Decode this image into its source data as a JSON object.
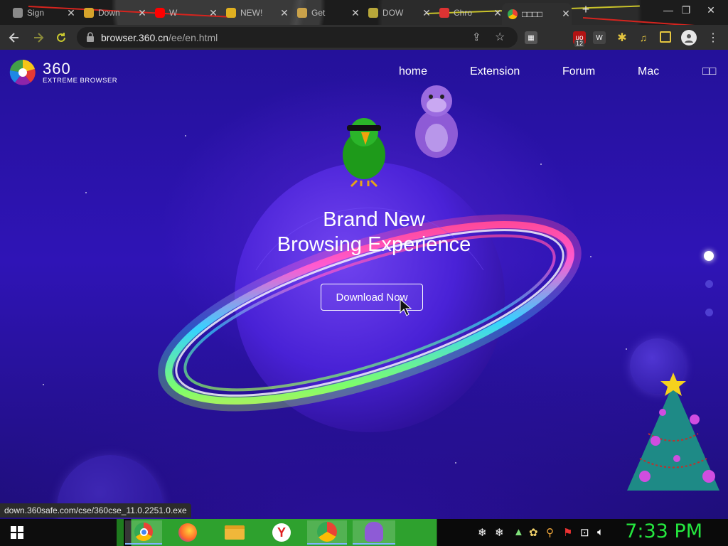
{
  "browser": {
    "tabs": [
      {
        "title": "Sign",
        "favicon_color": "#8a8a8a",
        "active": false
      },
      {
        "title": "Down",
        "favicon_color": "#d5a32b",
        "active": false
      },
      {
        "title": "W",
        "favicon_color": "#ff0000",
        "active": false
      },
      {
        "title": "NEW!",
        "favicon_color": "#e0b020",
        "active": false
      },
      {
        "title": "Get",
        "favicon_color": "#caa24a",
        "active": false
      },
      {
        "title": "DOW",
        "favicon_color": "#b8a73a",
        "active": false
      },
      {
        "title": "Chro",
        "favicon_color": "#d33",
        "active": false
      },
      {
        "title": "□□□□",
        "favicon_color": "#4285f4",
        "active": true
      }
    ],
    "new_tab_label": "+",
    "window_controls": {
      "minimize": "—",
      "maximize": "❐",
      "close": "✕"
    },
    "toolbar": {
      "back_icon": "arrow-left-icon",
      "forward_icon": "arrow-right-icon",
      "reload_icon": "reload-icon",
      "url_host": "browser.360.cn",
      "url_path": "/ee/en.html",
      "extension_badge": "12"
    },
    "status_url": "down.360safe.com/cse/360cse_11.0.2251.0.exe"
  },
  "site": {
    "logo_number": "360",
    "logo_subtitle": "EXTREME BROWSER",
    "nav": [
      "home",
      "Extension",
      "Forum",
      "Mac",
      "□□"
    ],
    "hero_line1": "Brand New",
    "hero_line2": "Browsing Experience",
    "download_label": "Download Now"
  },
  "taskbar": {
    "clock": "7:33 PM",
    "apps": [
      "windows-start-icon",
      "chrome-icon",
      "firefox-icon",
      "file-explorer-icon",
      "yandex-icon",
      "chrome-app-icon",
      "bonzi-icon"
    ]
  }
}
